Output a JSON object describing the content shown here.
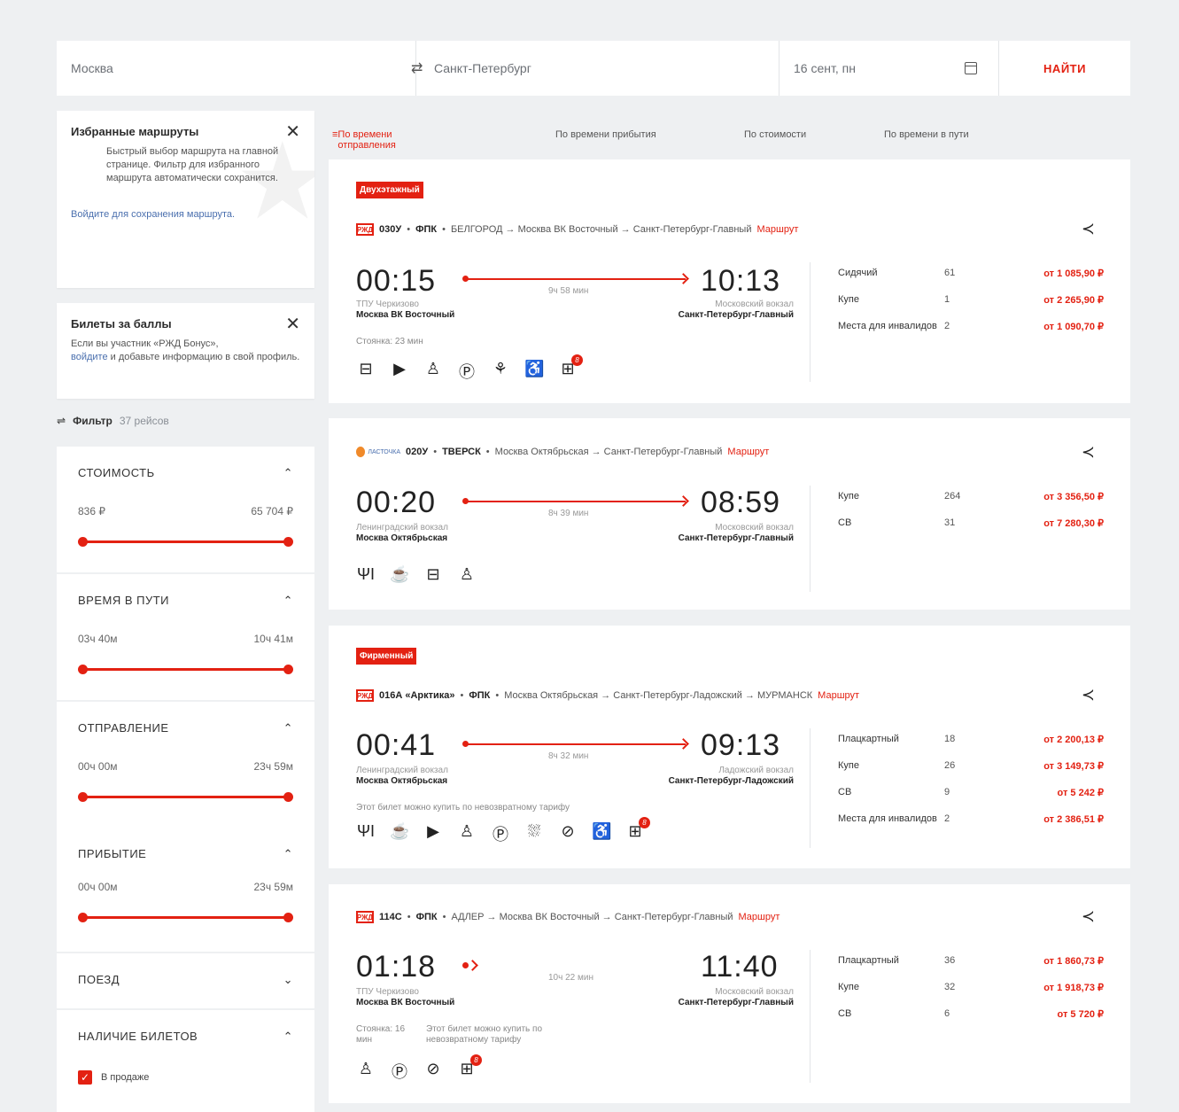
{
  "search": {
    "from": "Москва",
    "swap_icon": "swap-icon",
    "to": "Санкт-Петербург",
    "date": "16 сент, пн",
    "find": "НАЙТИ"
  },
  "favorites": {
    "title": "Избранные маршруты",
    "text": "Быстрый выбор маршрута на главной странице. Фильтр для избранного маршрута автоматически сохранится.",
    "link": "Войдите для сохранения маршрута."
  },
  "bonus": {
    "title": "Билеты за баллы",
    "text1": "Если вы участник «РЖД Бонус»,",
    "link": "войдите",
    "text2": "и добавьте информацию в свой профиль."
  },
  "filter": {
    "label": "Фильтр",
    "count": "37 рейсов"
  },
  "filters": [
    {
      "title": "Стоимость",
      "min": "836 ₽",
      "max": "65 704 ₽"
    },
    {
      "title": "Время в пути",
      "min": "03ч 40м",
      "max": "10ч 41м"
    },
    {
      "title": "Отправление",
      "min": "00ч 00м",
      "max": "23ч 59м"
    },
    {
      "title": "Прибытие",
      "min": "00ч 00м",
      "max": "23ч 59м"
    },
    {
      "title": "Поезд"
    },
    {
      "title": "Наличие билетов",
      "check": "В продаже"
    }
  ],
  "sorts": [
    "По времени отправления",
    "По времени прибытия",
    "По стоимости",
    "По времени в пути"
  ],
  "trains": [
    {
      "badge": "Двухэтажный",
      "logo": "РЖД",
      "number": "030У",
      "carrier": "ФПК",
      "route": "БЕЛГОРОД → Москва ВК Восточный → Санкт-Петербург-Главный",
      "route_link": "Маршрут",
      "dep": "00:15",
      "arr": "10:13",
      "duration": "9ч 58 мин",
      "dep_a": "ТПУ Черкизово",
      "dep_b": "Москва ВК Восточный",
      "arr_a": "Московский вокзал",
      "arr_b": "Санкт-Петербург-Главный",
      "note": "Стоянка: 23 мин",
      "icons": [
        "bed-icon",
        "video-icon",
        "toilet-icon",
        "parking-icon",
        "pet-icon",
        "wheelchair-icon",
        "luggage-icon"
      ],
      "badge_count": "8",
      "seats": [
        {
          "cls": "Сидячий",
          "qty": "61",
          "price": "от 1 085,90 ₽"
        },
        {
          "cls": "Купе",
          "qty": "1",
          "price": "от 2 265,90 ₽"
        },
        {
          "cls": "Места для инвалидов",
          "qty": "2",
          "price": "от 1 090,70 ₽"
        }
      ]
    },
    {
      "logo": "ЛАСТОЧКА",
      "number": "020У",
      "carrier": "ТВЕРСК",
      "route": "Москва Октябрьская → Санкт-Петербург-Главный",
      "route_link": "Маршрут",
      "dep": "00:20",
      "arr": "08:59",
      "duration": "8ч 39 мин",
      "dep_a": "Ленинградский вокзал",
      "dep_b": "Москва Октябрьская",
      "arr_a": "Московский вокзал",
      "arr_b": "Санкт-Петербург-Главный",
      "icons": [
        "food-icon",
        "coffee-icon",
        "bed-icon",
        "toilet-icon"
      ],
      "seats": [
        {
          "cls": "Купе",
          "qty": "264",
          "price": "от 3 356,50 ₽"
        },
        {
          "cls": "СВ",
          "qty": "31",
          "price": "от 7 280,30 ₽"
        }
      ]
    },
    {
      "badge": "Фирменный",
      "logo": "РЖД",
      "number": "016А «Арктика»",
      "carrier": "ФПК",
      "route": "Москва Октябрьская → Санкт-Петербург-Ладожский → МУРМАНСК",
      "route_link": "Маршрут",
      "dep": "00:41",
      "arr": "09:13",
      "duration": "8ч 32 мин",
      "dep_a": "Ленинградский вокзал",
      "dep_b": "Москва Октябрьская",
      "arr_a": "Ладожский вокзал",
      "arr_b": "Санкт-Петербург-Ладожский",
      "note": "Этот билет можно купить по невозвратному тарифу",
      "icons": [
        "food-icon",
        "coffee-icon",
        "video-icon",
        "toilet-icon",
        "parking-icon",
        "shower-icon",
        "no-smoking-icon",
        "wheelchair-icon",
        "luggage-icon"
      ],
      "badge_count": "8",
      "seats": [
        {
          "cls": "Плацкартный",
          "qty": "18",
          "price": "от 2 200,13 ₽"
        },
        {
          "cls": "Купе",
          "qty": "26",
          "price": "от 3 149,73 ₽"
        },
        {
          "cls": "СВ",
          "qty": "9",
          "price": "от 5 242 ₽"
        },
        {
          "cls": "Места для инвалидов",
          "qty": "2",
          "price": "от 2 386,51 ₽"
        }
      ]
    },
    {
      "logo": "РЖД",
      "number": "114С",
      "carrier": "ФПК",
      "route": "АДЛЕР → Москва ВК Восточный → Санкт-Петербург-Главный",
      "route_link": "Маршрут",
      "dep": "01:18",
      "arr": "11:40",
      "duration": "10ч 22 мин",
      "dep_a": "ТПУ Черкизово",
      "dep_b": "Москва ВК Восточный",
      "arr_a": "Московский вокзал",
      "arr_b": "Санкт-Петербург-Главный",
      "note": "Стоянка: 16 мин",
      "note2": "Этот билет можно купить по невозвратному тарифу",
      "icons": [
        "toilet-icon",
        "parking-icon",
        "no-smoking-icon",
        "luggage-icon"
      ],
      "badge_count": "8",
      "seats": [
        {
          "cls": "Плацкартный",
          "qty": "36",
          "price": "от 1 860,73 ₽"
        },
        {
          "cls": "Купе",
          "qty": "32",
          "price": "от 1 918,73 ₽"
        },
        {
          "cls": "СВ",
          "qty": "6",
          "price": "от 5 720 ₽"
        }
      ]
    }
  ]
}
